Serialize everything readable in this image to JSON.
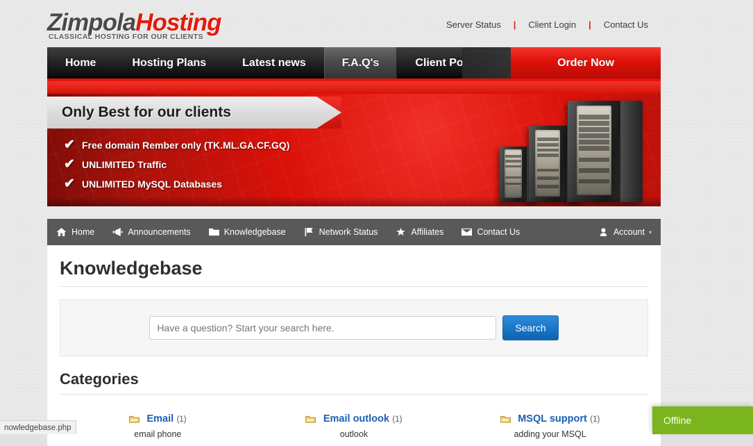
{
  "header": {
    "logo_part1": "Zimpola",
    "logo_part2": "Hosting",
    "tagline": "CLASSICAL HOSTING FOR OUR CLIENTS",
    "top_links": [
      {
        "label": "Server Status"
      },
      {
        "label": "Client Login"
      },
      {
        "label": "Contact Us"
      }
    ],
    "separator": "|"
  },
  "main_nav": {
    "items": [
      {
        "label": "Home",
        "active": false
      },
      {
        "label": "Hosting Plans",
        "active": false
      },
      {
        "label": "Latest news",
        "active": false
      },
      {
        "label": "F.A.Q's",
        "active": true
      },
      {
        "label": "Client Portal",
        "active": false
      }
    ],
    "cta_label": "Order Now",
    "accent_color": "#e8100a"
  },
  "banner": {
    "ribbon_title": "Only Best for our clients",
    "check_glyph": "✔",
    "features": [
      {
        "label": "Free domain Rember only (TK.ML.GA.CF.GQ)"
      },
      {
        "label": "UNLIMITED Traffic"
      },
      {
        "label": "UNLIMITED MySQL Databases"
      }
    ]
  },
  "sub_nav": {
    "items": [
      {
        "label": "Home",
        "icon": "home-icon"
      },
      {
        "label": "Announcements",
        "icon": "megaphone-icon"
      },
      {
        "label": "Knowledgebase",
        "icon": "folder-icon"
      },
      {
        "label": "Network Status",
        "icon": "flag-icon"
      },
      {
        "label": "Affiliates",
        "icon": "star-icon"
      },
      {
        "label": "Contact Us",
        "icon": "envelope-icon"
      }
    ],
    "account_label": "Account",
    "account_caret": "▾"
  },
  "page": {
    "title": "Knowledgebase",
    "search": {
      "placeholder": "Have a question? Start your search here.",
      "value": "",
      "button_label": "Search"
    },
    "categories_heading": "Categories",
    "categories": [
      {
        "name": "Email",
        "count": "(1)",
        "description": "email phone"
      },
      {
        "name": "Email outlook",
        "count": "(1)",
        "description": "outlook"
      },
      {
        "name": "MSQL support",
        "count": "(1)",
        "description": "adding your MSQL"
      }
    ]
  },
  "chat_widget": {
    "label": "Offline",
    "color": "#7ab51d"
  },
  "browser": {
    "status_url": "nowledgebase.php"
  }
}
